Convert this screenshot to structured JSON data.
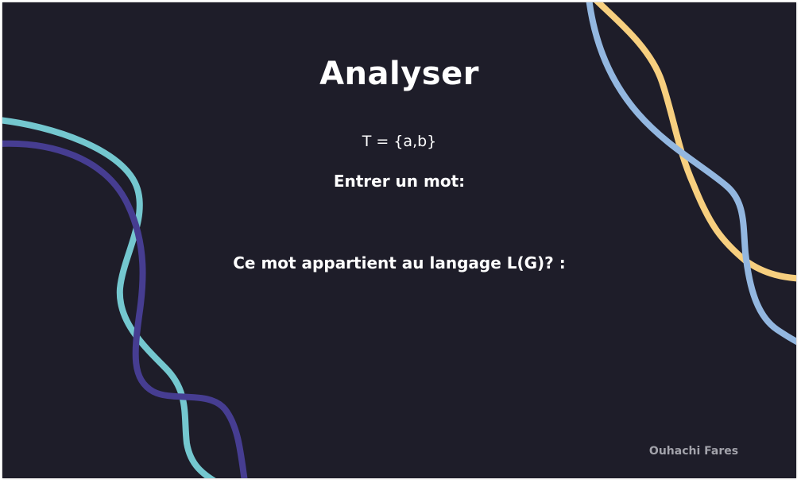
{
  "slide": {
    "title": "Analyser",
    "alphabet": "T = {a,b}",
    "input_label": "Entrer un mot:",
    "input_value": "",
    "input_placeholder": "",
    "result_label": "Ce mot appartient au langage L(G)? :",
    "result_value": "",
    "author": "Ouhachi Fares"
  },
  "colors": {
    "background": "#1e1d29",
    "text": "#ffffff",
    "author_text": "#a3a3ab",
    "curve_teal": "#74c7cf",
    "curve_indigo": "#463d91",
    "curve_yellow": "#f7cf7f",
    "curve_blue": "#93b7e0"
  }
}
